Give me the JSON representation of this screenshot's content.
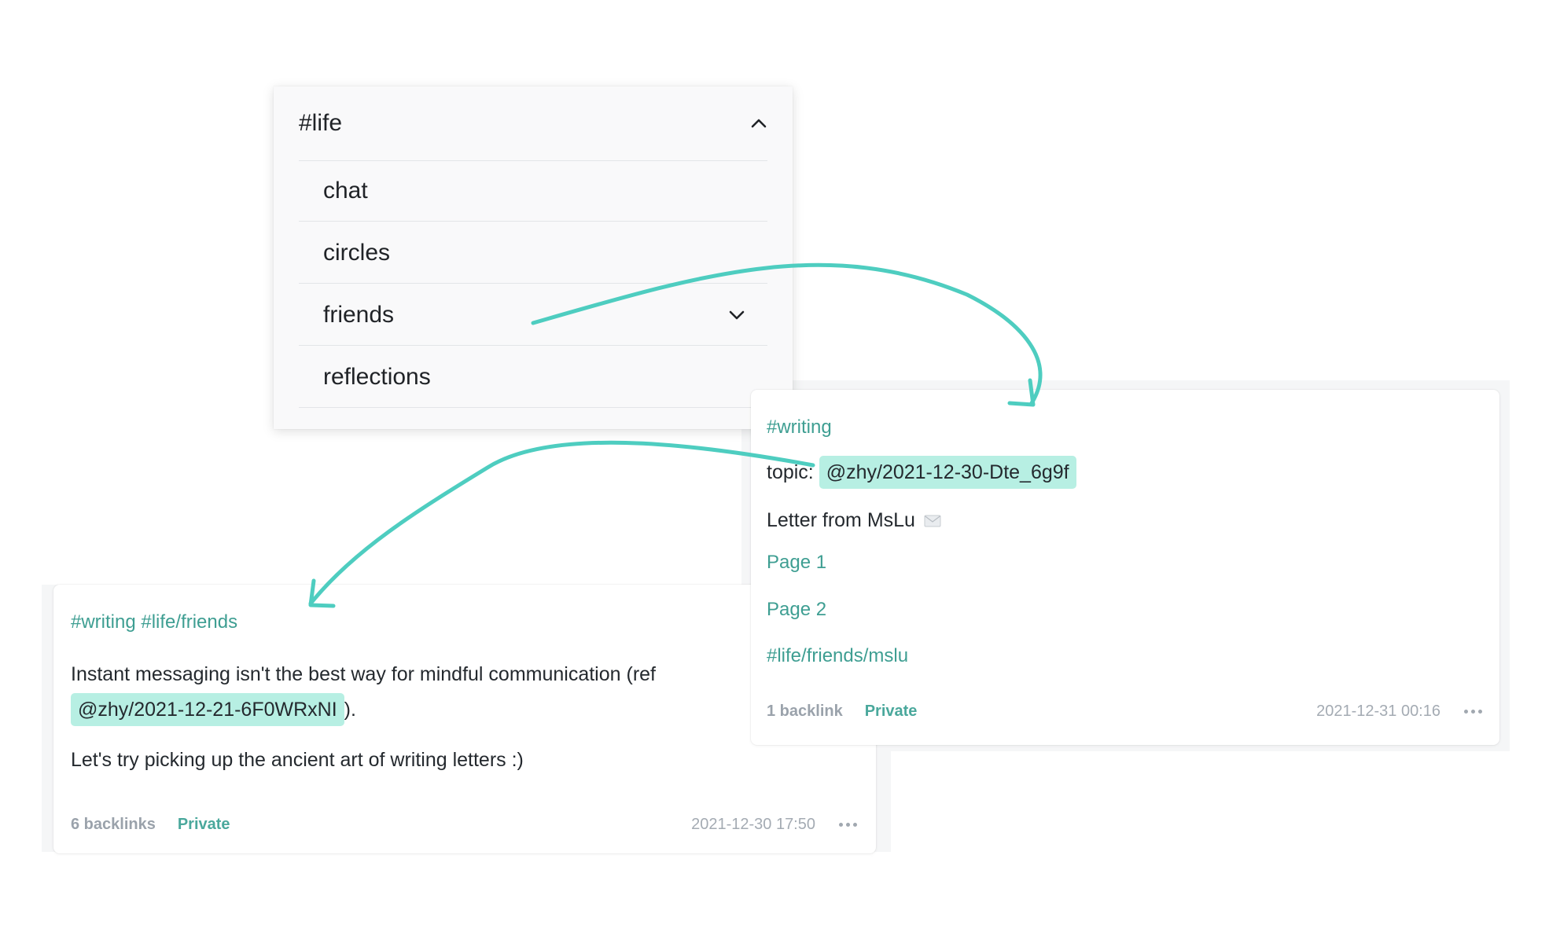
{
  "tag_dropdown": {
    "title": "#life",
    "toggle_icon": "chevron-up-icon",
    "items": [
      {
        "label": "chat"
      },
      {
        "label": "circles"
      },
      {
        "label": "friends",
        "icon": "chevron-down-icon"
      },
      {
        "label": "reflections"
      }
    ]
  },
  "memo_right": {
    "tag": "#writing",
    "topic_label": "topic:",
    "topic_ref": "@zhy/2021-12-30-Dte_6g9f",
    "line": "Letter from MsLu",
    "line_icon": "envelope-icon",
    "links": [
      "Page 1",
      "Page 2"
    ],
    "tag_bottom": "#life/friends/mslu",
    "footer": {
      "backlinks": "1 backlink",
      "visibility": "Private",
      "timestamp": "2021-12-31 00:16",
      "more_icon": "more-dots-icon"
    }
  },
  "memo_left": {
    "tags": "#writing #life/friends",
    "text1": "Instant messaging isn't the best way for mindful communication (ref",
    "ref": "@zhy/2021-12-21-6F0WRxNI",
    "text1_end": ").",
    "text2": "Let's try picking up the ancient art of writing letters :)",
    "footer": {
      "backlinks": "6 backlinks",
      "visibility": "Private",
      "timestamp": "2021-12-30 17:50",
      "more_icon": "more-dots-icon"
    }
  },
  "colors": {
    "accent": "#4ecdc0",
    "chip": "#b7efe3",
    "link": "#3e9e92"
  }
}
